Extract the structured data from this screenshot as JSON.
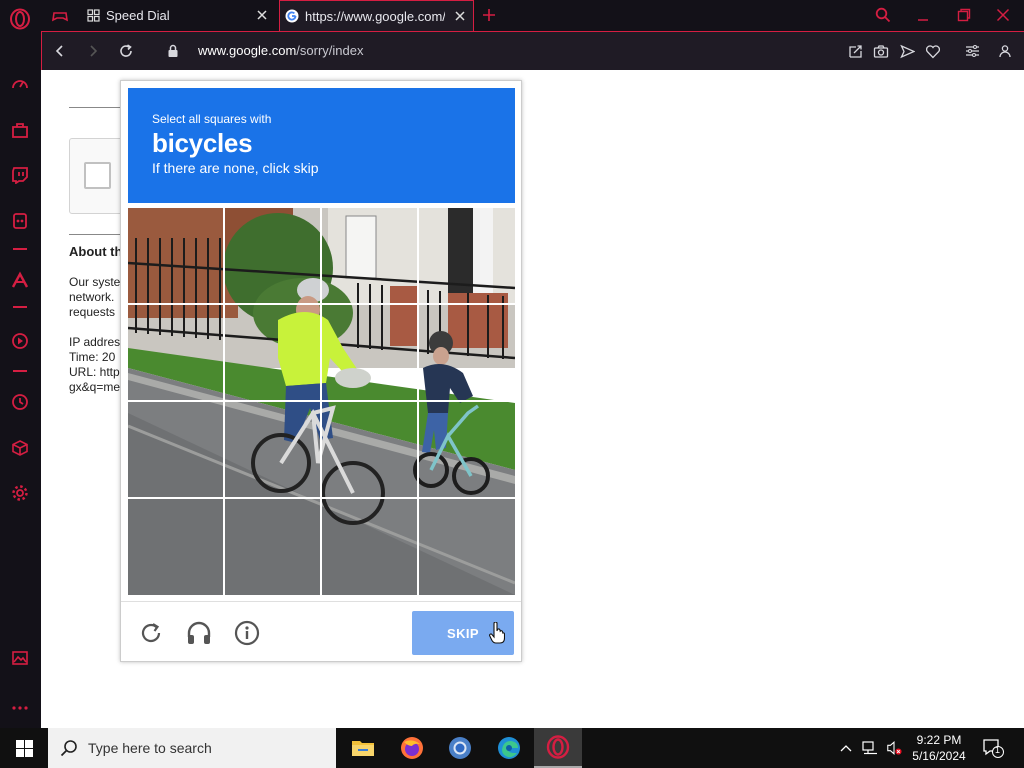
{
  "browser": {
    "tabs": [
      {
        "label": "Speed Dial",
        "active": false
      },
      {
        "label": "https://www.google.com/sorry/index",
        "active": true
      }
    ],
    "address": {
      "domain": "www.google.com",
      "path": "/sorry/index"
    },
    "accent_color": "#d51e42"
  },
  "page": {
    "about_heading": "About th",
    "para1": [
      "Our syste",
      "network.",
      "requests"
    ],
    "para2": [
      "IP addres",
      "Time: 20",
      "URL: http",
      "gx&q=me"
    ]
  },
  "captcha": {
    "instruction": "Select all squares with",
    "target": "bicycles",
    "hint": "If there are none, click skip",
    "skip_label": "SKIP",
    "header_color": "#1a73e8",
    "footer_icons": [
      "reload-icon",
      "audio-challenge-icon",
      "info-icon"
    ]
  },
  "taskbar": {
    "search_placeholder": "Type here to search",
    "time": "9:22 PM",
    "date": "5/16/2024",
    "notification_count": "1",
    "apps": [
      "file-explorer",
      "firefox",
      "chrome",
      "edge",
      "opera-gx"
    ]
  }
}
